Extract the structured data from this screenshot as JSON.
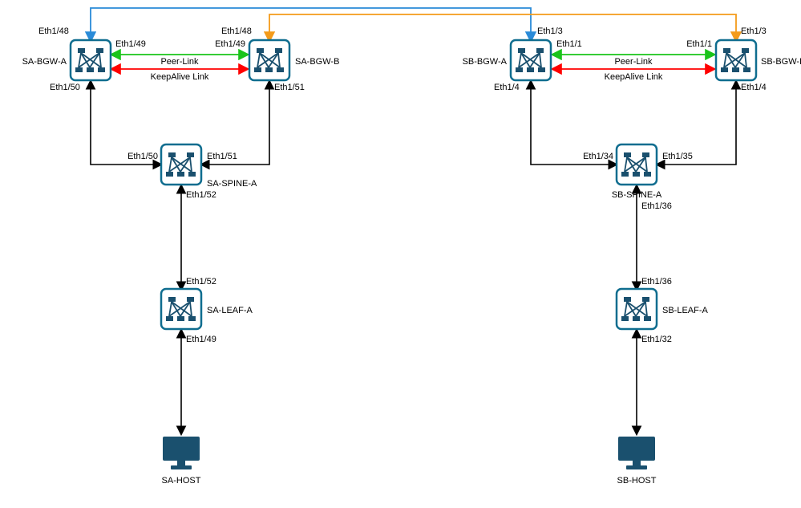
{
  "diagram": {
    "nodes": {
      "sa_bgw_a": {
        "label": "SA-BGW-A",
        "ports": {
          "top": "Eth1/48",
          "right": "Eth1/49",
          "bottom": "Eth1/50"
        }
      },
      "sa_bgw_b": {
        "label": "SA-BGW-B",
        "ports": {
          "top": "Eth1/48",
          "left": "Eth1/49",
          "bottom": "Eth1/51"
        }
      },
      "sb_bgw_a": {
        "label": "SB-BGW-A",
        "ports": {
          "top": "Eth1/3",
          "right": "Eth1/1",
          "bottom": "Eth1/4"
        }
      },
      "sb_bgw_b": {
        "label": "SB-BGW-B",
        "ports": {
          "top": "Eth1/3",
          "left": "Eth1/1",
          "bottom": "Eth1/4"
        }
      },
      "sa_spine_a": {
        "label": "SA-SPINE-A",
        "ports": {
          "left": "Eth1/50",
          "right": "Eth1/51",
          "bottom": "Eth1/52"
        }
      },
      "sb_spine_a": {
        "label": "SB-SPINE-A",
        "ports": {
          "left": "Eth1/34",
          "right": "Eth1/35",
          "bottom": "Eth1/36"
        }
      },
      "sa_leaf_a": {
        "label": "SA-LEAF-A",
        "ports": {
          "top": "Eth1/52",
          "bottom": "Eth1/49"
        }
      },
      "sb_leaf_a": {
        "label": "SB-LEAF-A",
        "ports": {
          "top": "Eth1/36",
          "bottom": "Eth1/32"
        }
      },
      "sa_host": {
        "label": "SA-HOST"
      },
      "sb_host": {
        "label": "SB-HOST"
      }
    },
    "links": {
      "peer": "Peer-Link",
      "keepalive": "KeepAlive Link"
    },
    "colors": {
      "node_stroke": "#0f6d8f",
      "node_fill": "#ffffff",
      "glyph": "#1a506e",
      "monitor": "#1a506e",
      "black": "#000000",
      "green": "#1ac41a",
      "red": "#ff0000",
      "blue": "#2a8bd8",
      "orange": "#f49b1a"
    }
  }
}
